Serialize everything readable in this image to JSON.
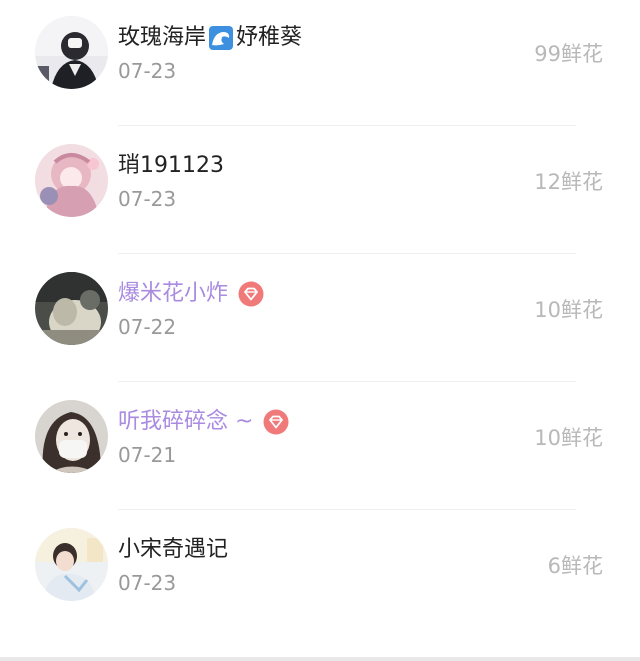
{
  "items": [
    {
      "name_part1": "玫瑰海岸",
      "emoji_icon": "wave-emoji",
      "name_part2": "妤稚葵",
      "date": "07-23",
      "flowers": "99鲜花",
      "vip": false
    },
    {
      "name_part1": "琑191123",
      "date": "07-23",
      "flowers": "12鲜花",
      "vip": false
    },
    {
      "name_part1": "爆米花小炸",
      "date": "07-22",
      "flowers": "10鲜花",
      "vip": true,
      "badge_icon": "diamond-badge-icon"
    },
    {
      "name_part1": "听我碎碎念 ~",
      "date": "07-21",
      "flowers": "10鲜花",
      "vip": true,
      "badge_icon": "diamond-badge-icon"
    },
    {
      "name_part1": "小宋奇遇记",
      "date": "07-23",
      "flowers": "6鲜花",
      "vip": false
    }
  ],
  "colors": {
    "name_default": "#222222",
    "name_vip": "#a98be0",
    "date": "#999999",
    "flowers": "#b8b8b8",
    "badge": "#f07a7a"
  }
}
